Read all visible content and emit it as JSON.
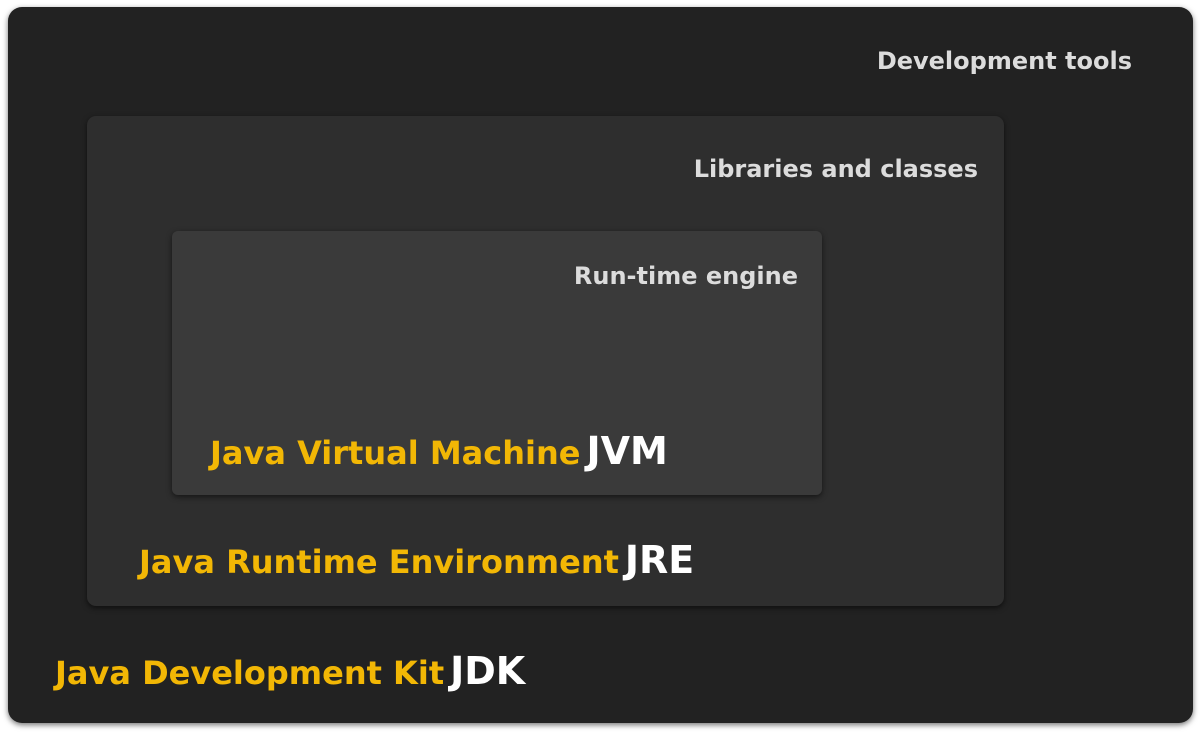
{
  "jdk": {
    "name": "Java Development Kit",
    "abbr": "JDK",
    "component": "Development tools"
  },
  "jre": {
    "name": "Java Runtime Environment",
    "abbr": "JRE",
    "component": "Libraries and classes"
  },
  "jvm": {
    "name": "Java Virtual Machine",
    "abbr": "JVM",
    "component": "Run-time engine"
  },
  "colors": {
    "jdk_background": "#222222",
    "jre_background": "#2e2e2e",
    "jvm_background": "#3a3a3a",
    "name_accent": "#f2b705",
    "abbreviation": "#ffffff",
    "component_text": "#dcdcdc"
  }
}
